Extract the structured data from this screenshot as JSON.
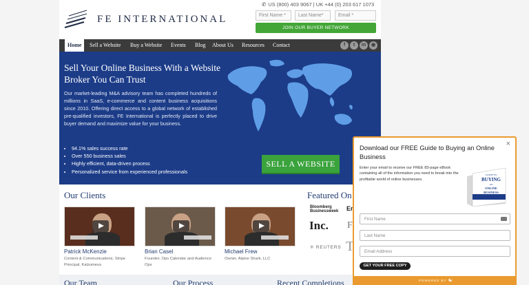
{
  "brand": {
    "name": "FE INTERNATIONAL"
  },
  "header": {
    "phone_text": "US (800) 403 9067 | UK +44 (0) 203 617 1073",
    "first_name_placeholder": "First Name *",
    "last_name_placeholder": "Last Name*",
    "email_placeholder": "Email *",
    "join_label": "JOIN OUR BUYER NETWORK"
  },
  "nav": {
    "items": [
      {
        "label": "Home",
        "active": true
      },
      {
        "label": "Sell a Website"
      },
      {
        "label": "Buy a Website"
      },
      {
        "label": "Events"
      },
      {
        "label": "Blog"
      },
      {
        "label": "About Us"
      },
      {
        "label": "Resources"
      },
      {
        "label": "Contact"
      }
    ],
    "social": [
      "facebook-icon",
      "twitter-icon",
      "linkedin-icon",
      "instagram-icon"
    ]
  },
  "hero": {
    "title": "Sell Your Online Business With a Website Broker You Can Trust",
    "description": "Our market-leading M&A advisory team has completed hundreds of millions in SaaS, e-commerce and content business acquisitions since 2010. Offering direct access to a global network of established pre-qualified investors, FE International is perfectly placed to drive buyer demand and maximize value for your business.",
    "bullets": [
      "94.1% sales success rate",
      "Over 550 business sales",
      "Highly efficient, data-driven process",
      "Personalized service from experienced professionals"
    ],
    "cta_label": "SELL A WEBSITE"
  },
  "clients": {
    "title": "Our Clients",
    "items": [
      {
        "name": "Patrick McKenzie",
        "role": "Content & Communications, Stripe Principal, Kalzumeus"
      },
      {
        "name": "Brian Casel",
        "role": "Founder, Ops Calendar and Audience Ops"
      },
      {
        "name": "Michael Frew",
        "role": "Owner, Alpine Shark, LLC"
      }
    ]
  },
  "featured": {
    "title": "Featured On",
    "logos": [
      "Bloomberg Businessweek",
      "En",
      "Inc.",
      "F",
      "REUTERS",
      "T"
    ]
  },
  "bottom": {
    "titles": [
      "Our Team",
      "Our Process",
      "Recent Completions"
    ]
  },
  "popup": {
    "title": "Download our FREE Guide to Buying an Online Business",
    "description": "Enter your email to receive our FREE 83-page eBook containing all of the information you need to break into the profitable world of online businesses.",
    "ebook_line1": "GUIDE TO",
    "ebook_line2": "BUYING",
    "ebook_line3": "AN",
    "ebook_line4": "ONLINE BUSINESS",
    "first_name_placeholder": "First Name",
    "last_name_placeholder": "Last Name",
    "email_placeholder": "Email Address",
    "cta_label": "GET YOUR FREE COPY",
    "footer": "POWERED BY"
  },
  "colors": {
    "accent_green": "#43a637",
    "hero_blue": "#1c3c88",
    "popup_orange": "#ea9a2e",
    "nav_dark": "#3b3b3b"
  }
}
